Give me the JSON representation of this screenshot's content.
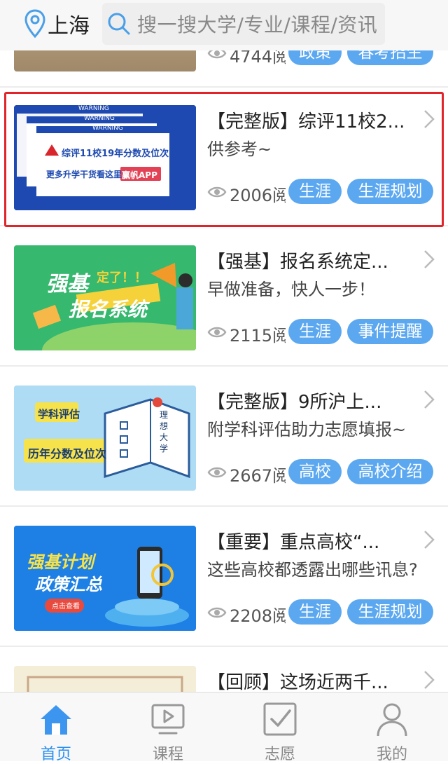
{
  "header": {
    "city": "上海",
    "search_placeholder": "搜一搜大学/专业/课程/资讯"
  },
  "articles": [
    {
      "title": "",
      "desc": "",
      "views": "4744阅",
      "tags": [
        "政策",
        "春考招生"
      ]
    },
    {
      "title": "【完整版】综评11校2...",
      "desc": "供参考~",
      "views": "2006阅",
      "tags": [
        "生涯",
        "生涯规划"
      ],
      "thumb": {
        "warning_label": "WARNING",
        "headline": "综评11校19年分数及位次",
        "subline": "更多升学干货看这里",
        "button": "赢帆APP"
      }
    },
    {
      "title": "【强基】报名系统定...",
      "desc": "早做准备，快人一步！",
      "views": "2115阅读",
      "tags": [
        "生涯",
        "事件提醒"
      ],
      "thumb": {
        "line1": "强基",
        "line2": "报名系统",
        "sticker": "定了！！"
      }
    },
    {
      "title": "【完整版】9所沪上...",
      "desc": "附学科评估助力志愿填报~",
      "views": "2667阅",
      "tags": [
        "高校",
        "高校介绍"
      ],
      "thumb": {
        "label1": "学科评估",
        "label2": "历年分数及位次",
        "book_text": "理想大学"
      }
    },
    {
      "title": "【重要】重点高校“...",
      "desc": "这些高校都透露出哪些讯息?",
      "views": "2208阅",
      "tags": [
        "生涯",
        "生涯规划"
      ],
      "thumb": {
        "line1": "强基计划",
        "line2": "政策汇总",
        "button": "点击查看"
      }
    },
    {
      "title": "【回顾】这场近两千...",
      "desc": "",
      "views": "",
      "tags": []
    }
  ],
  "tabs": [
    {
      "label": "首页",
      "icon": "home-icon",
      "active": true
    },
    {
      "label": "课程",
      "icon": "play-icon",
      "active": false
    },
    {
      "label": "志愿",
      "icon": "checkbox-icon",
      "active": false
    },
    {
      "label": "我的",
      "icon": "user-icon",
      "active": false
    }
  ],
  "colors": {
    "accent": "#2a8ff0",
    "tag_bg": "#5ca8f0",
    "highlight": "#e0242a"
  }
}
